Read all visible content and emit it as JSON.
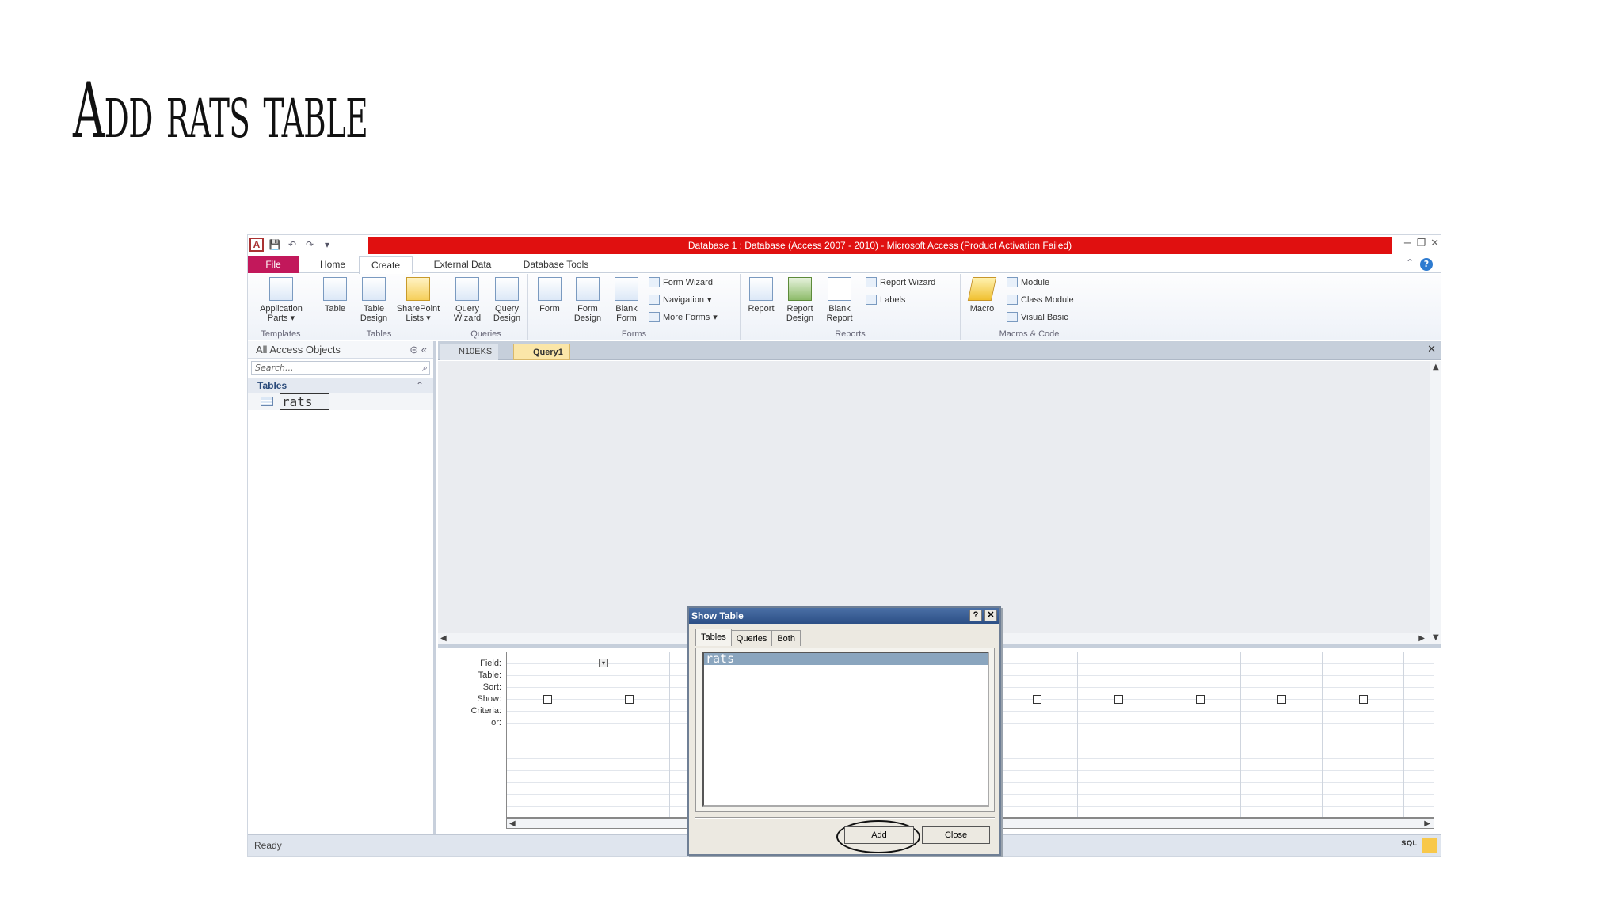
{
  "slide": {
    "title": "Add rats table"
  },
  "window": {
    "title": "Database 1 : Database (Access 2007 - 2010)  -  Microsoft Access (Product Activation Failed)",
    "logo_letter": "A",
    "accent_color": "#e01010"
  },
  "ribbon_tabs": [
    "File",
    "Home",
    "Create",
    "External Data",
    "Database Tools"
  ],
  "ribbon": {
    "templates": {
      "label": "Templates",
      "app_parts_1": "Application",
      "app_parts_2": "Parts"
    },
    "tables": {
      "label": "Tables",
      "table": "Table",
      "table_design_1": "Table",
      "table_design_2": "Design",
      "sharepoint_1": "SharePoint",
      "sharepoint_2": "Lists"
    },
    "queries": {
      "label": "Queries",
      "wizard_1": "Query",
      "wizard_2": "Wizard",
      "design_1": "Query",
      "design_2": "Design"
    },
    "forms": {
      "label": "Forms",
      "form": "Form",
      "form_design_1": "Form",
      "form_design_2": "Design",
      "blank_1": "Blank",
      "blank_2": "Form",
      "wizard": "Form Wizard",
      "navigation": "Navigation",
      "more": "More Forms"
    },
    "reports": {
      "label": "Reports",
      "report": "Report",
      "design_1": "Report",
      "design_2": "Design",
      "blank_1": "Blank",
      "blank_2": "Report",
      "wizard": "Report Wizard",
      "labels": "Labels"
    },
    "macros": {
      "label": "Macros & Code",
      "macro": "Macro",
      "module": "Module",
      "class_module": "Class Module",
      "visual_basic": "Visual Basic"
    }
  },
  "nav": {
    "header": "All Access Objects",
    "search_placeholder": "Search...",
    "section": "Tables",
    "items": [
      {
        "label": "rats"
      }
    ]
  },
  "doc_tabs": [
    "N10EKS",
    "Query1"
  ],
  "query_grid": {
    "row_labels": [
      "Field:",
      "Table:",
      "Sort:",
      "Show:",
      "Criteria:",
      "or:"
    ]
  },
  "status": {
    "text": "Ready",
    "sql": "SQL"
  },
  "dialog": {
    "title": "Show Table",
    "help": "?",
    "close_x": "✕",
    "tabs": [
      "Tables",
      "Queries",
      "Both"
    ],
    "list": [
      "rats"
    ],
    "add_label": "Add",
    "close_label": "Close"
  }
}
